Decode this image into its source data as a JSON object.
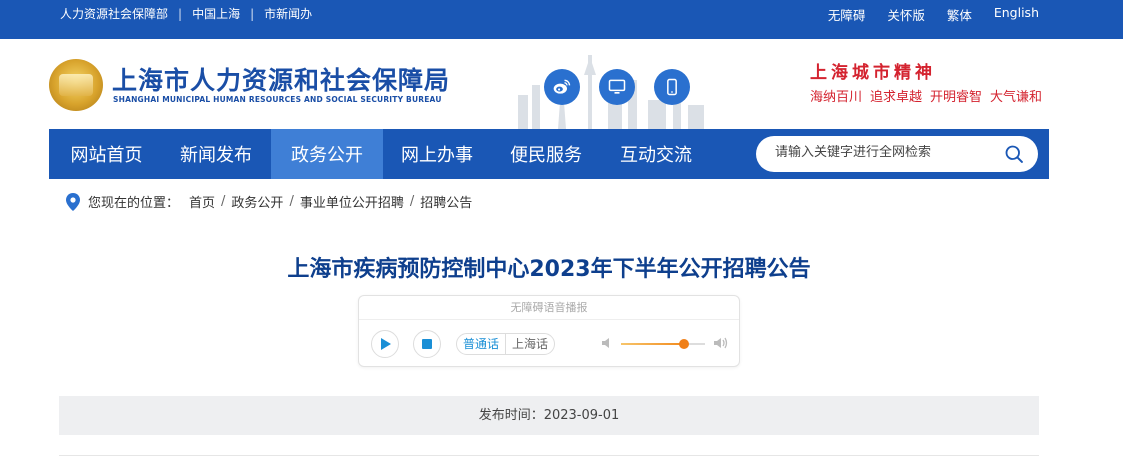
{
  "topbar": {
    "left_links": [
      "人力资源社会保障部",
      "中国上海",
      "市新闻办"
    ],
    "right_links": [
      "无障碍",
      "关怀版",
      "繁体",
      "English"
    ]
  },
  "header": {
    "title": "上海市人力资源和社会保障局",
    "subtitle": "SHANGHAI MUNICIPAL HUMAN RESOURCES AND SOCIAL SECURITY BUREAU",
    "icons": [
      "weibo-icon",
      "desktop-icon",
      "mobile-icon"
    ],
    "spirit_title": "上海城市精神",
    "spirit_words": [
      "海纳百川",
      "追求卓越",
      "开明睿智",
      "大气谦和"
    ]
  },
  "nav": {
    "items": [
      {
        "label": "网站首页"
      },
      {
        "label": "新闻发布"
      },
      {
        "label": "政务公开"
      },
      {
        "label": "网上办事"
      },
      {
        "label": "便民服务"
      },
      {
        "label": "互动交流"
      }
    ],
    "active": "政务公开",
    "search_placeholder": "请输入关键字进行全网检索"
  },
  "breadcrumb": {
    "label": "您现在的位置：",
    "items": [
      "首页",
      "政务公开",
      "事业单位公开招聘",
      "招聘公告"
    ]
  },
  "article": {
    "title": "上海市疾病预防控制中心2023年下半年公开招聘公告",
    "player": {
      "header": "无障碍语音播报",
      "lang_active": "普通话",
      "lang_other": "上海话",
      "volume_fraction": 0.75
    },
    "publish": "发布时间：2023-09-01"
  },
  "colors": {
    "brand_blue": "#1a57b5",
    "nav_active": "#3f7fd6",
    "title_blue": "#0e3f8d",
    "spirit_red": "#d4232f"
  }
}
